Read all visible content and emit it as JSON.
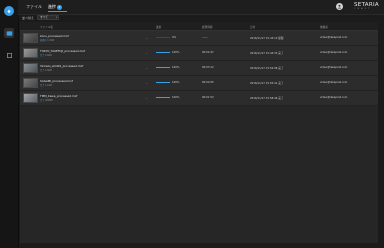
{
  "nav": {
    "tabs": [
      {
        "label": "ファイル"
      },
      {
        "label": "進捗",
        "badge": "2"
      }
    ],
    "active_tab": 1
  },
  "brand": {
    "name": "SETARIA",
    "sub": "C R A F T"
  },
  "sort": {
    "label": "並べ替え",
    "value": "すべて"
  },
  "table": {
    "headers": [
      "ファイル名",
      "進捗",
      "処理時間",
      "日付",
      "依頼者"
    ],
    "rows": [
      {
        "name": "kiuiu_processed.mxf",
        "sub_tag": "処理中",
        "sub": "1.2GB",
        "progress": 0.0,
        "progress_text": "0%",
        "duration": "------",
        "date": "2016/11/17 15:43:12 保留",
        "user": "video@takapost.com"
      },
      {
        "name": "TOKYO_TAKEFUJI_processed.mxf",
        "sub_tag": "完了",
        "sub": "2.0GB",
        "progress": 1.0,
        "progress_text": "100%",
        "duration": "00:02:47",
        "date": "2016/11/17 15:44:33 完了",
        "user": "video@takapost.com"
      },
      {
        "name": "Yamazo_wild02_processed.mxf",
        "sub_tag": "完了",
        "sub": "1.6GB",
        "progress": 1.0,
        "progress_text": "100%",
        "duration": "00:03:12",
        "date": "2016/11/17 15:52:08 完了",
        "user": "video@takapost.com"
      },
      {
        "name": "SAGAMI_processed.mxf",
        "sub_tag": "完了",
        "sub": "1.1GB",
        "progress": 1.0,
        "progress_text": "100%",
        "duration": "00:02:05",
        "date": "2016/11/17 15:55:41 完了",
        "user": "video@takapost.com"
      },
      {
        "name": "TMM_Kawa_processed.mxf",
        "sub_tag": "完了",
        "sub": "900MB",
        "progress": 1.0,
        "progress_text": "100%",
        "duration": "00:01:52",
        "date": "2016/11/17 15:58:46 完了",
        "user": "video@takapost.com"
      }
    ]
  },
  "colors": {
    "accent": "#3aa0e6",
    "bg": "#1b1b1b",
    "row": "#2c2c2c"
  }
}
